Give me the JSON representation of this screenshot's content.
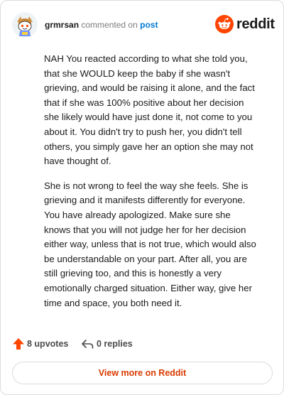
{
  "comment": {
    "author": "grmrsan",
    "action_text": "commented on",
    "post_link_text": "post",
    "avatar_icon": "reddit-snoo-avatar-icon",
    "paragraphs": [
      "NAH You reacted according to what she told you, that she WOULD keep the baby if she wasn't grieving, and would be raising it alone, and the fact that if she was 100% positive about her decision she likely would have just done it, not come to you about it. You didn't try to push her, you didn't tell others, you simply gave her an option she may not have thought of.",
      "She is not wrong to feel the way she feels. She is grieving and it manifests differently for everyone. You have already apologized. Make sure she knows that you will not judge her for her decision either way, unless that is not true, which would also be understandable on your part. After all, you are still grieving too, and this is honestly a very emotionally charged situation. Either way, give her time and space, you both need it."
    ]
  },
  "brand": {
    "wordmark": "reddit",
    "icon": "reddit-logo-icon",
    "color": "#ff4500"
  },
  "footer": {
    "upvotes_label": "8 upvotes",
    "upvote_icon": "upvote-arrow-icon",
    "upvote_color": "#ff4500",
    "replies_label": "0 replies",
    "reply_icon": "reply-arrow-icon"
  },
  "view_more_label": "View more on Reddit",
  "view_more_color": "#d93a00"
}
